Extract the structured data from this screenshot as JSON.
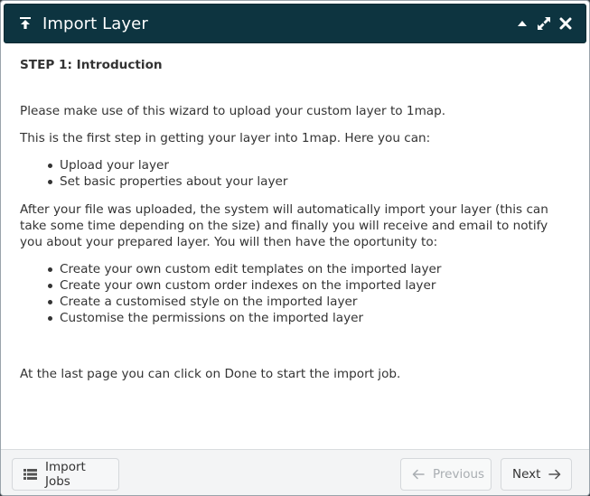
{
  "window": {
    "title": "Import Layer",
    "title_icon": "upload-icon",
    "actions": [
      "collapse-icon",
      "maximize-icon",
      "close-icon"
    ]
  },
  "step": {
    "title": "STEP 1: Introduction",
    "intro": "Please make use of this wizard to upload your custom layer to 1map.",
    "first_step": "This is the first step in getting your layer into 1map. Here you can:",
    "capabilities": [
      "Upload your layer",
      "Set basic properties about your layer"
    ],
    "after_upload": "After your file was uploaded, the system will automatically import your layer (this can take some time depending on the size) and finally you will receive and email to notify you about your prepared layer. You will then have the oportunity to:",
    "opportunities": [
      "Create your own custom edit templates on the imported layer",
      "Create your own custom order indexes on the imported layer",
      "Create a customised style on the imported layer",
      "Customise the permissions on the imported layer"
    ],
    "last_page": "At the last page you can click on Done to start the import job."
  },
  "footer": {
    "import_jobs_label": "Import Jobs",
    "previous_label": "Previous",
    "next_label": "Next"
  },
  "colors": {
    "titlebar": "#0d3440",
    "footer": "#f3f4f5",
    "text": "#333333",
    "disabled": "#a9aeb2"
  }
}
